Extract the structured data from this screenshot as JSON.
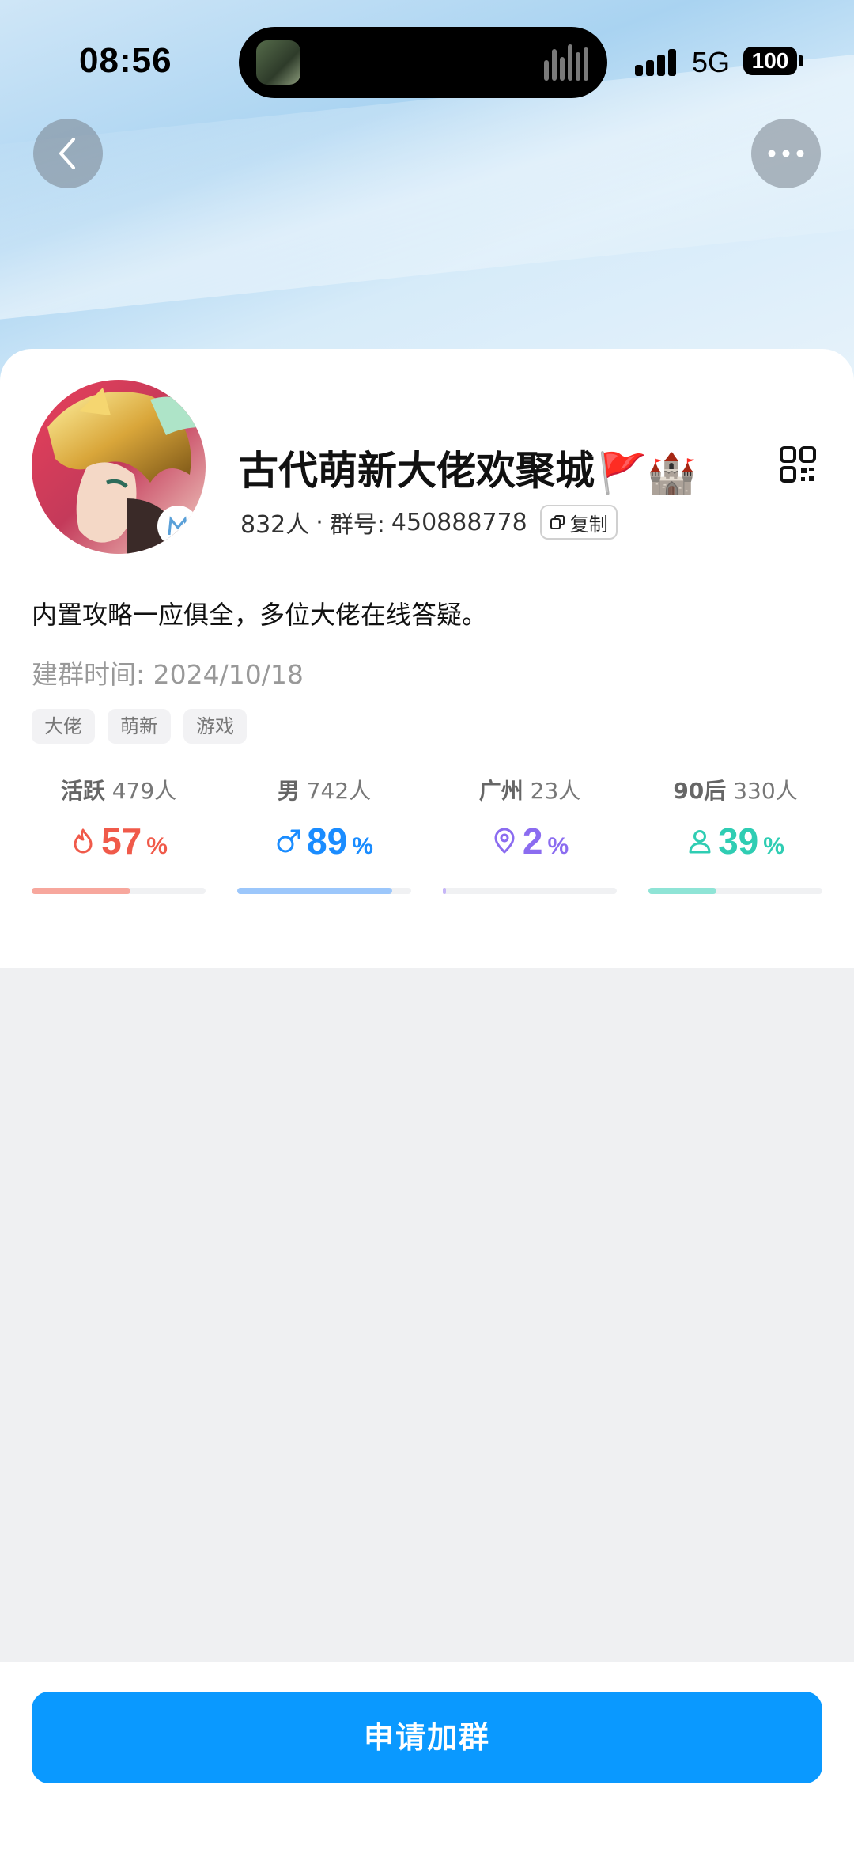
{
  "status_bar": {
    "time": "08:56",
    "network": "5G",
    "battery": "100"
  },
  "header": {
    "back_icon": "chevron-left-icon",
    "more_icon": "more-dots-icon"
  },
  "group": {
    "name": "古代萌新大佬欢聚城",
    "name_emoji": "🚩🏰",
    "member_count": "832人",
    "separator": "·",
    "group_id_label": "群号:",
    "group_id": "450888778",
    "copy_label": "复制",
    "description": "内置攻略一应俱全，多位大佬在线答疑。",
    "created_label": "建群时间:",
    "created_date": "2024/10/18",
    "tags": [
      "大佬",
      "萌新",
      "游戏"
    ]
  },
  "stats": [
    {
      "label": "活跃",
      "count": "479人",
      "value": "57",
      "unit": "%",
      "icon": "fire-icon",
      "color": "#f05a4a",
      "fill": 0.57,
      "track_color": "#f7a79d"
    },
    {
      "label": "男",
      "count": "742人",
      "value": "89",
      "unit": "%",
      "icon": "male-icon",
      "color": "#1a8cff",
      "fill": 0.89,
      "track_color": "#9cc7fb"
    },
    {
      "label": "广州",
      "count": "23人",
      "value": "2",
      "unit": "%",
      "icon": "location-pin-icon",
      "color": "#8b6cf0",
      "fill": 0.02,
      "track_color": "#c6b6f7"
    },
    {
      "label": "90后",
      "count": "330人",
      "value": "39",
      "unit": "%",
      "icon": "person-icon",
      "color": "#2fcdb3",
      "fill": 0.39,
      "track_color": "#8fe4d6"
    }
  ],
  "footer": {
    "join_label": "申请加群"
  }
}
